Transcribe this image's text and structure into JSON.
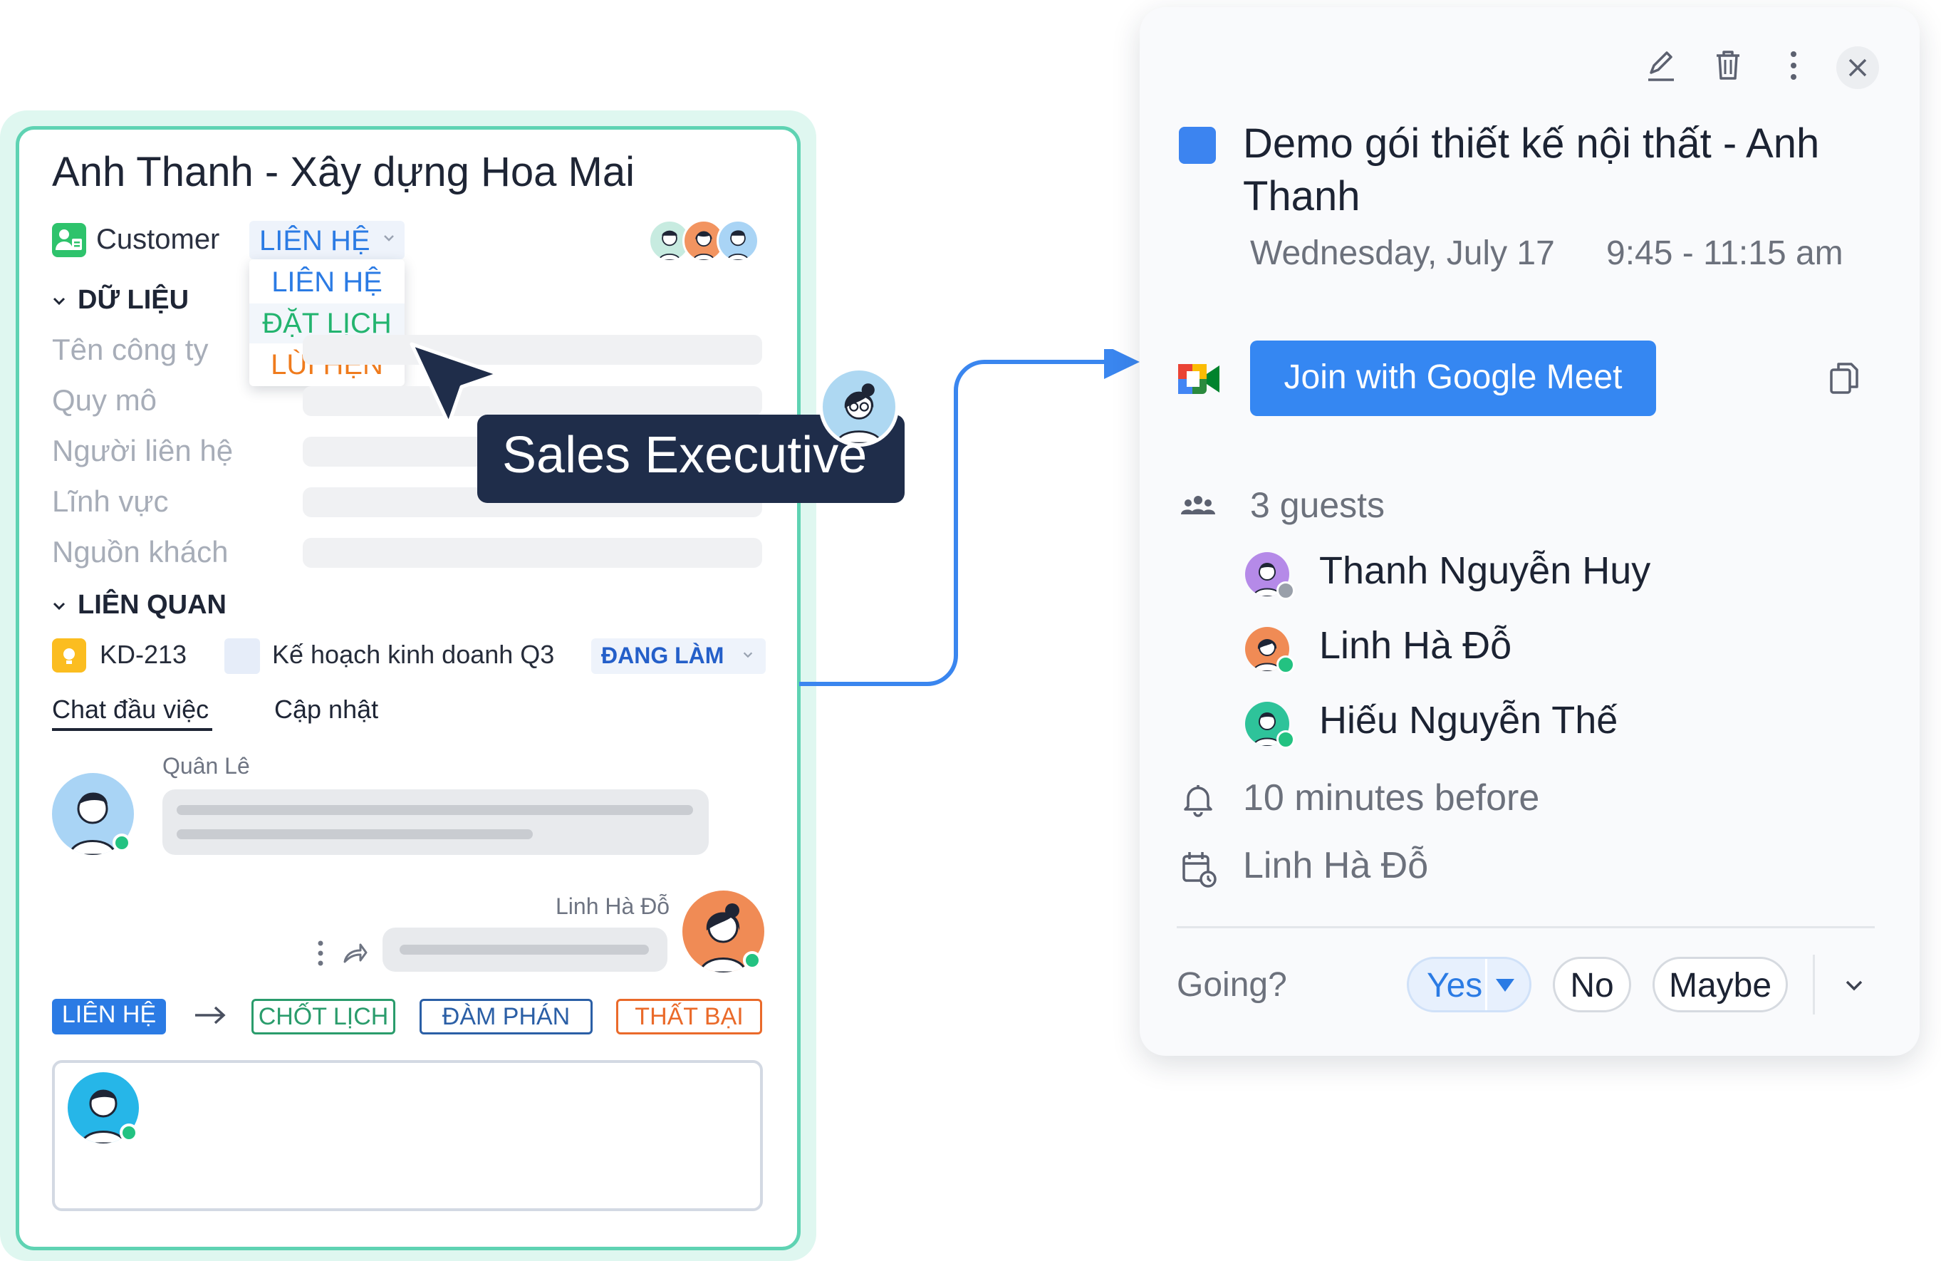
{
  "card": {
    "title": "Anh Thanh - Xây dựng Hoa Mai",
    "customer_label": "Customer",
    "status_selected": "LIÊN HỆ",
    "status_options": [
      "LIÊN HỆ",
      "ĐẶT LỊCH",
      "LÙI HẸN"
    ],
    "section_data": "DỮ LIỆU",
    "fields": [
      "Tên công ty",
      "Quy mô",
      "Người liên hệ",
      "Lĩnh vực",
      "Nguồn khách"
    ],
    "section_related": "LIÊN QUAN",
    "task_code": "KD-213",
    "task_name": "Kế hoạch kinh doanh Q3",
    "task_status": "ĐANG LÀM",
    "tabs": [
      "Chat đầu việc",
      "Cập nhật"
    ],
    "messages": [
      {
        "author": "Quân Lê"
      },
      {
        "author": "Linh Hà Đỗ"
      }
    ],
    "stages": [
      "LIÊN HỆ",
      "CHỐT LỊCH",
      "ĐÀM PHÁN",
      "THẤT BẠI"
    ]
  },
  "tooltip": {
    "label": "Sales Executive"
  },
  "event": {
    "title": "Demo gói thiết kế nội thất - Anh Thanh",
    "date": "Wednesday, July 17",
    "time": "9:45 - 11:15 am",
    "meet_button": "Join with Google Meet",
    "guests_count": "3 guests",
    "guests": [
      "Thanh Nguyễn Huy",
      "Linh Hà Đỗ",
      "Hiếu Nguyễn Thế"
    ],
    "reminder": "10 minutes before",
    "organizer": "Linh Hà Đỗ",
    "going_label": "Going?",
    "rsvp": {
      "yes": "Yes",
      "no": "No",
      "maybe": "Maybe"
    }
  },
  "colors": {
    "accent_blue": "#2b7be4",
    "card_border": "#5fd3b3",
    "tooltip_bg": "#1f2d4a",
    "meet_button": "#3587f2"
  }
}
